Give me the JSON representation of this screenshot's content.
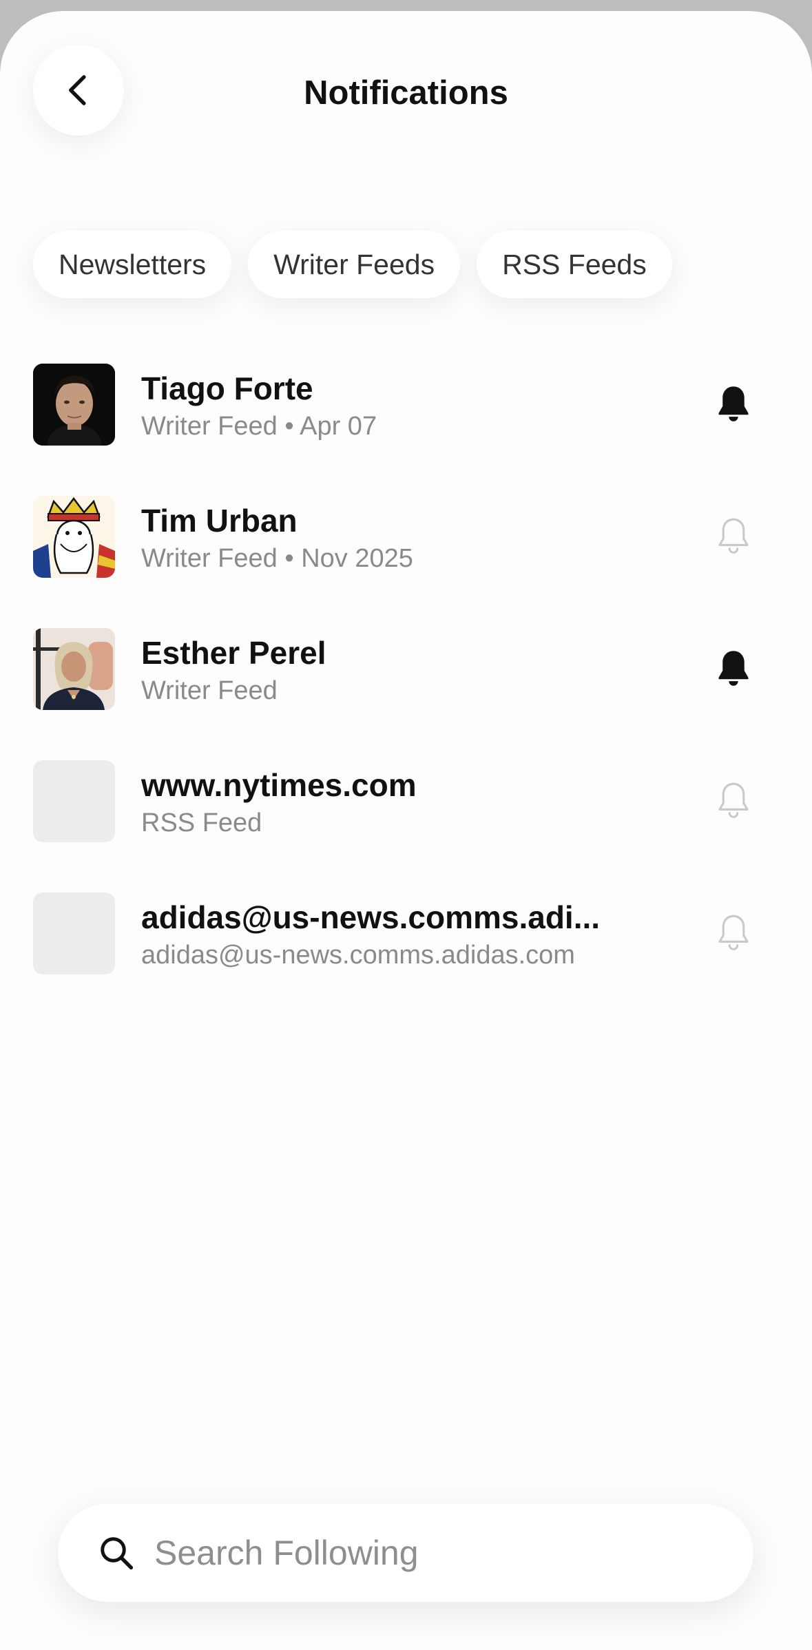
{
  "header": {
    "title": "Notifications",
    "back_icon": "chevron-left-icon"
  },
  "filters": [
    {
      "label": "Newsletters"
    },
    {
      "label": "Writer Feeds"
    },
    {
      "label": "RSS Feeds"
    }
  ],
  "items": [
    {
      "name": "Tiago Forte",
      "subtitle": "Writer Feed • Apr 07",
      "avatar": "portrait-photo",
      "notifications_on": true
    },
    {
      "name": "Tim Urban",
      "subtitle": "Writer Feed • Nov 2025",
      "avatar": "king-card-illustration",
      "notifications_on": false
    },
    {
      "name": "Esther Perel",
      "subtitle": "Writer Feed",
      "avatar": "portrait-photo",
      "notifications_on": true
    },
    {
      "name": "www.nytimes.com",
      "subtitle": "RSS Feed",
      "avatar": "placeholder",
      "notifications_on": false
    },
    {
      "name": "adidas@us-news.comms.adi...",
      "subtitle": "adidas@us-news.comms.adidas.com",
      "avatar": "placeholder",
      "notifications_on": false
    }
  ],
  "search": {
    "placeholder": "Search Following",
    "value": ""
  },
  "colors": {
    "bell_on": "#111111",
    "bell_off": "#c9c9c9",
    "placeholder_avatar": "#ececec"
  }
}
